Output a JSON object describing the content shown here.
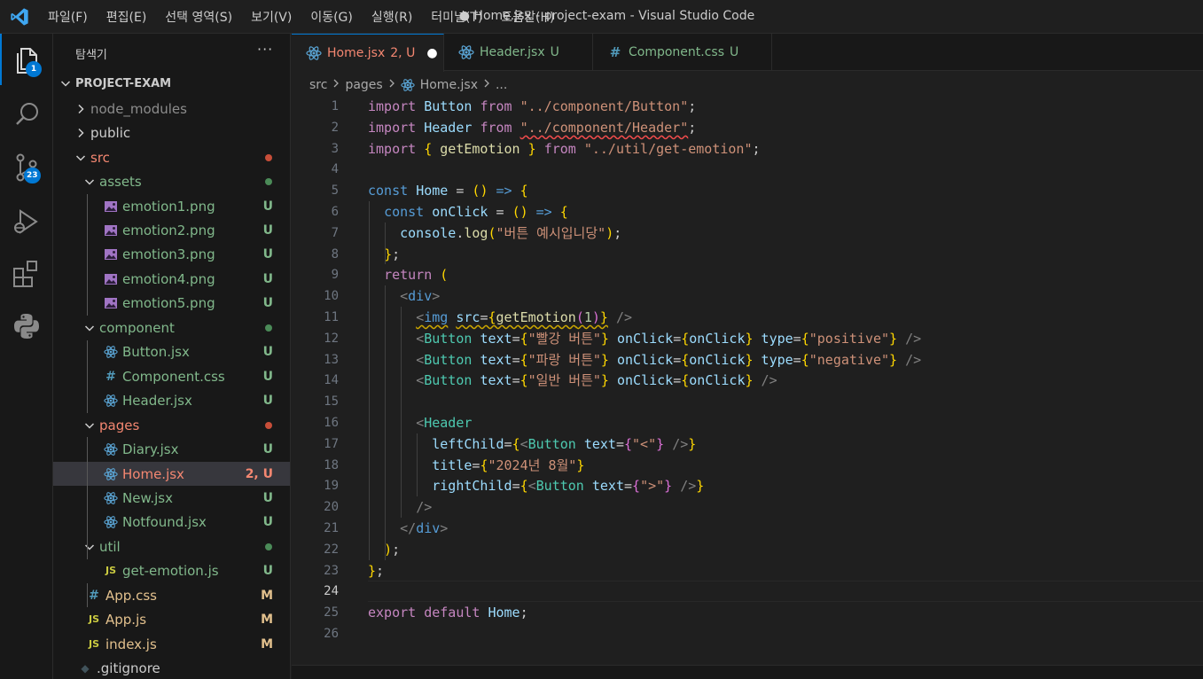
{
  "titlebar": {
    "menu": [
      "파일(F)",
      "편집(E)",
      "선택 영역(S)",
      "보기(V)",
      "이동(G)",
      "실행(R)",
      "터미널(T)",
      "도움말(H)"
    ],
    "window_title": "● Home.jsx - project-exam - Visual Studio Code"
  },
  "activitybar": {
    "items": [
      {
        "icon": "files-icon",
        "badge": "1"
      },
      {
        "icon": "search-icon"
      },
      {
        "icon": "source-control-icon",
        "badge": "23"
      },
      {
        "icon": "run-debug-icon"
      },
      {
        "icon": "extensions-icon"
      },
      {
        "icon": "python-icon"
      }
    ]
  },
  "sidebar": {
    "title": "탐색기",
    "more": "···",
    "project": "PROJECT-EXAM",
    "tree": [
      {
        "label": "node_modules",
        "type": "folder",
        "open": false,
        "depth": 0,
        "color": "#8c8c8c",
        "status": ""
      },
      {
        "label": "public",
        "type": "folder",
        "open": false,
        "depth": 0,
        "color": "#cccccc",
        "status": ""
      },
      {
        "label": "src",
        "type": "folder",
        "open": true,
        "depth": 0,
        "color": "#f48771",
        "dot": "#c74e39"
      },
      {
        "label": "assets",
        "type": "folder",
        "open": true,
        "depth": 1,
        "color": "#81b88b",
        "dot": "#4b8b58"
      },
      {
        "label": "emotion1.png",
        "type": "image",
        "depth": 2,
        "color": "#81b88b",
        "status": "U",
        "statusColor": "#81b88b"
      },
      {
        "label": "emotion2.png",
        "type": "image",
        "depth": 2,
        "color": "#81b88b",
        "status": "U",
        "statusColor": "#81b88b"
      },
      {
        "label": "emotion3.png",
        "type": "image",
        "depth": 2,
        "color": "#81b88b",
        "status": "U",
        "statusColor": "#81b88b"
      },
      {
        "label": "emotion4.png",
        "type": "image",
        "depth": 2,
        "color": "#81b88b",
        "status": "U",
        "statusColor": "#81b88b"
      },
      {
        "label": "emotion5.png",
        "type": "image",
        "depth": 2,
        "color": "#81b88b",
        "status": "U",
        "statusColor": "#81b88b"
      },
      {
        "label": "component",
        "type": "folder",
        "open": true,
        "depth": 1,
        "color": "#81b88b",
        "dot": "#4b8b58"
      },
      {
        "label": "Button.jsx",
        "type": "react",
        "depth": 2,
        "color": "#81b88b",
        "status": "U",
        "statusColor": "#81b88b"
      },
      {
        "label": "Component.css",
        "type": "css",
        "depth": 2,
        "color": "#81b88b",
        "status": "U",
        "statusColor": "#81b88b"
      },
      {
        "label": "Header.jsx",
        "type": "react",
        "depth": 2,
        "color": "#81b88b",
        "status": "U",
        "statusColor": "#81b88b"
      },
      {
        "label": "pages",
        "type": "folder",
        "open": true,
        "depth": 1,
        "color": "#f48771",
        "dot": "#c74e39"
      },
      {
        "label": "Diary.jsx",
        "type": "react",
        "depth": 2,
        "color": "#81b88b",
        "status": "U",
        "statusColor": "#81b88b"
      },
      {
        "label": "Home.jsx",
        "type": "react",
        "depth": 2,
        "color": "#f48771",
        "status": "2, U",
        "statusColor": "#f48771",
        "selected": true
      },
      {
        "label": "New.jsx",
        "type": "react",
        "depth": 2,
        "color": "#81b88b",
        "status": "U",
        "statusColor": "#81b88b"
      },
      {
        "label": "Notfound.jsx",
        "type": "react",
        "depth": 2,
        "color": "#81b88b",
        "status": "U",
        "statusColor": "#81b88b"
      },
      {
        "label": "util",
        "type": "folder",
        "open": true,
        "depth": 1,
        "color": "#81b88b",
        "dot": "#4b8b58"
      },
      {
        "label": "get-emotion.js",
        "type": "js",
        "depth": 2,
        "color": "#81b88b",
        "status": "U",
        "statusColor": "#81b88b"
      },
      {
        "label": "App.css",
        "type": "css",
        "depth": 1,
        "color": "#e2c08d",
        "status": "M",
        "statusColor": "#e2c08d"
      },
      {
        "label": "App.js",
        "type": "js",
        "depth": 1,
        "color": "#e2c08d",
        "status": "M",
        "statusColor": "#e2c08d"
      },
      {
        "label": "index.js",
        "type": "js",
        "depth": 1,
        "color": "#e2c08d",
        "status": "M",
        "statusColor": "#e2c08d"
      },
      {
        "label": ".gitignore",
        "type": "git",
        "depth": 0,
        "color": "#cccccc",
        "status": ""
      }
    ]
  },
  "tabs": [
    {
      "label": "Home.jsx",
      "status": "2, U",
      "icon": "react-icon",
      "color": "#f48771",
      "active": true,
      "dirty": "●"
    },
    {
      "label": "Header.jsx",
      "status": "U",
      "icon": "react-icon",
      "color": "#81b88b",
      "active": false
    },
    {
      "label": "Component.css",
      "status": "U",
      "icon": "css-icon",
      "color": "#81b88b",
      "active": false
    }
  ],
  "breadcrumb": [
    "src",
    "pages",
    "Home.jsx",
    "..."
  ],
  "editor": {
    "current_line": 24,
    "lines": [
      "import Button from \"../component/Button\";",
      "import Header from \"../component/Header\";",
      "import { getEmotion } from \"../util/get-emotion\";",
      "",
      "const Home = () => {",
      "  const onClick = () => {",
      "    console.log(\"버튼 예시입니당\");",
      "  };",
      "  return (",
      "    <div>",
      "      <img src={getEmotion(1)} />",
      "      <Button text={\"빨강 버튼\"} onClick={onClick} type={\"positive\"} />",
      "      <Button text={\"파랑 버튼\"} onClick={onClick} type={\"negative\"} />",
      "      <Button text={\"일반 버튼\"} onClick={onClick} />",
      "",
      "      <Header",
      "        leftChild={<Button text={\"<\"} />}",
      "        title={\"2024년 8월\"}",
      "        rightChild={<Button text={\">\"} />}",
      "      />",
      "    </div>",
      "  );",
      "};",
      "",
      "export default Home;",
      ""
    ]
  }
}
